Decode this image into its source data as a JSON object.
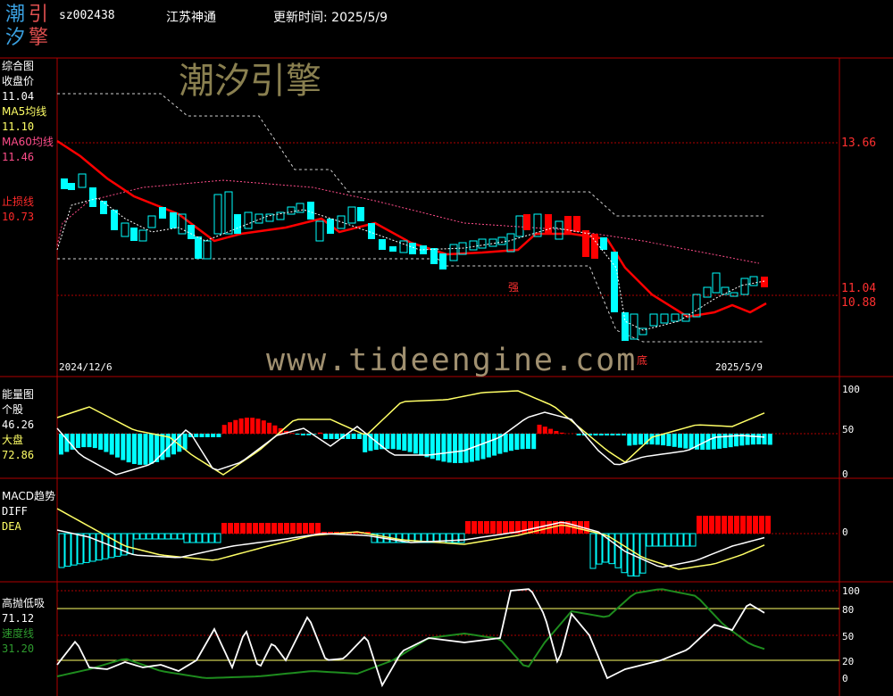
{
  "header": {
    "logo_chars": [
      "潮",
      "引",
      "汐",
      "擎"
    ],
    "code": "sz002438",
    "name": "江苏神通",
    "update_label": "更新时间: 2025/5/9"
  },
  "colors": {
    "up": "#ff0000",
    "down": "#00ffff",
    "ma5": "#ffff66",
    "ma60": "#ff4d8a",
    "stop": "#ff0000",
    "green": "#1e8c1e",
    "grid_red": "#b00000"
  },
  "main_panel": {
    "title": "综合图",
    "close_label": "收盘价",
    "close_value": "11.04",
    "ma5_label": "MA5均线",
    "ma5_value": "11.10",
    "ma60_label": "MA60均线",
    "ma60_value": "11.46",
    "stop_label": "止损线",
    "stop_value": "10.73",
    "right_ticks": [
      "13.66",
      "11.04",
      "10.88"
    ],
    "watermark": "潮汐引擎",
    "url_watermark": "www.tideengine.com",
    "date_start": "2024/12/6",
    "date_end": "2025/5/9",
    "marker_strong": "强",
    "marker_bottom": "底"
  },
  "energy_panel": {
    "title": "能量图",
    "stock_label": "个股",
    "stock_value": "46.26",
    "market_label": "大盘",
    "market_value": "72.86",
    "ticks": [
      "100",
      "50",
      "0"
    ]
  },
  "macd_panel": {
    "title": "MACD趋势",
    "diff_label": "DIFF",
    "dea_label": "DEA",
    "ticks": [
      "0"
    ]
  },
  "hl_panel": {
    "title": "高抛低吸",
    "value1": "71.12",
    "speed_label": "速度线",
    "speed_value": "31.20",
    "ticks": [
      "100",
      "80",
      "50",
      "20",
      "0"
    ]
  }
}
